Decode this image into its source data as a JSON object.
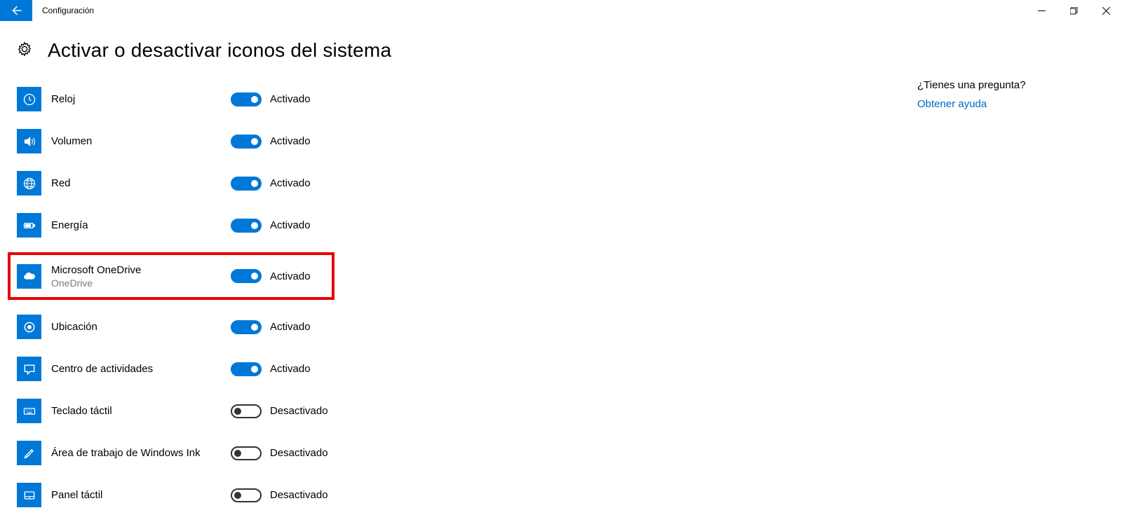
{
  "titlebar": {
    "app_name": "Configuración"
  },
  "page": {
    "title": "Activar o desactivar iconos del sistema"
  },
  "toggle_labels": {
    "on": "Activado",
    "off": "Desactivado"
  },
  "items": [
    {
      "icon": "clock",
      "label": "Reloj",
      "sublabel": null,
      "state": "on",
      "highlighted": false
    },
    {
      "icon": "volume",
      "label": "Volumen",
      "sublabel": null,
      "state": "on",
      "highlighted": false
    },
    {
      "icon": "network",
      "label": "Red",
      "sublabel": null,
      "state": "on",
      "highlighted": false
    },
    {
      "icon": "power",
      "label": "Energía",
      "sublabel": null,
      "state": "on",
      "highlighted": false
    },
    {
      "icon": "onedrive",
      "label": "Microsoft OneDrive",
      "sublabel": "OneDrive",
      "state": "on",
      "highlighted": true
    },
    {
      "icon": "location",
      "label": "Ubicación",
      "sublabel": null,
      "state": "on",
      "highlighted": false
    },
    {
      "icon": "actioncenter",
      "label": "Centro de actividades",
      "sublabel": null,
      "state": "on",
      "highlighted": false
    },
    {
      "icon": "keyboard",
      "label": "Teclado táctil",
      "sublabel": null,
      "state": "off",
      "highlighted": false
    },
    {
      "icon": "ink",
      "label": "Área de trabajo de Windows Ink",
      "sublabel": null,
      "state": "off",
      "highlighted": false
    },
    {
      "icon": "touchpad",
      "label": "Panel táctil",
      "sublabel": null,
      "state": "off",
      "highlighted": false
    }
  ],
  "help": {
    "heading": "¿Tienes una pregunta?",
    "link": "Obtener ayuda"
  }
}
